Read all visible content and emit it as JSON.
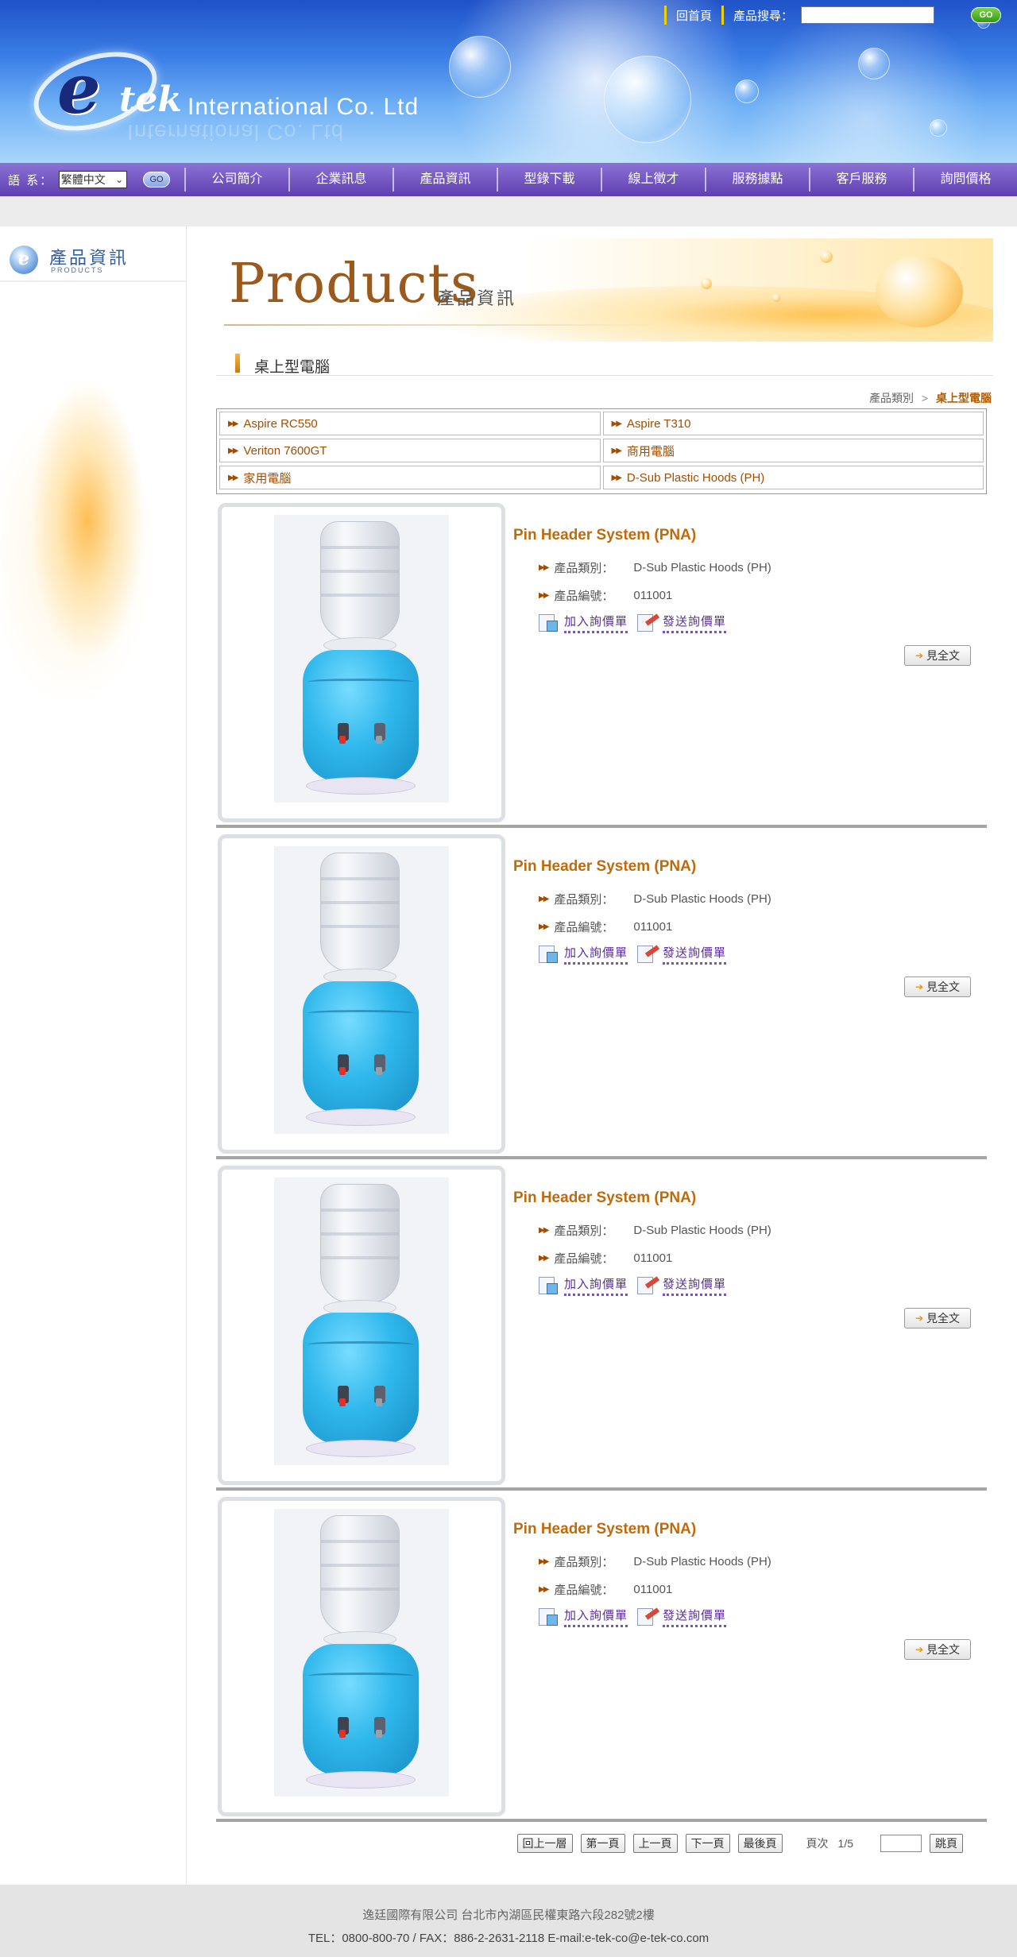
{
  "header": {
    "logo_letter": "e",
    "logo_tek": "tek",
    "company_name": "International Co. Ltd",
    "home_link": "回首頁",
    "search_label": "產品搜尋：",
    "search_value": "",
    "search_go": "GO"
  },
  "nav": {
    "lang_label": "語 系：",
    "lang_value": "繁體中文",
    "lang_go": "GO",
    "items": [
      "公司簡介",
      "企業訊息",
      "產品資訊",
      "型錄下載",
      "線上徵才",
      "服務據點",
      "客戶服務",
      "詢問價格"
    ]
  },
  "sidebar": {
    "title_zh": "產品資訊",
    "title_en": "PRODUCTS"
  },
  "banner": {
    "title_en": "Products",
    "title_zh": "產品資訊"
  },
  "category": {
    "heading": "桌上型電腦",
    "breadcrumb_root": "產品類別",
    "breadcrumb_sep": ">",
    "breadcrumb_current": "桌上型電腦",
    "links": [
      "Aspire RC550",
      "Aspire T310",
      "Veriton 7600GT",
      "商用電腦",
      "家用電腦",
      "D-Sub Plastic Hoods (PH)"
    ]
  },
  "products": [
    {
      "name": "Pin Header System (PNA)",
      "category_label": "產品類別：",
      "category_value": "D-Sub Plastic Hoods (PH)",
      "code_label": "產品編號：",
      "code_value": "011001",
      "add_label": "加入詢價單",
      "send_label": "發送詢價單",
      "full_label": "見全文"
    },
    {
      "name": "Pin Header System (PNA)",
      "category_label": "產品類別：",
      "category_value": "D-Sub Plastic Hoods (PH)",
      "code_label": "產品編號：",
      "code_value": "011001",
      "add_label": "加入詢價單",
      "send_label": "發送詢價單",
      "full_label": "見全文"
    },
    {
      "name": "Pin Header System (PNA)",
      "category_label": "產品類別：",
      "category_value": "D-Sub Plastic Hoods (PH)",
      "code_label": "產品編號：",
      "code_value": "011001",
      "add_label": "加入詢價單",
      "send_label": "發送詢價單",
      "full_label": "見全文"
    },
    {
      "name": "Pin Header System (PNA)",
      "category_label": "產品類別：",
      "category_value": "D-Sub Plastic Hoods (PH)",
      "code_label": "產品編號：",
      "code_value": "011001",
      "add_label": "加入詢價單",
      "send_label": "發送詢價單",
      "full_label": "見全文"
    }
  ],
  "pager": {
    "up": "回上一層",
    "first": "第一頁",
    "prev": "上一頁",
    "next": "下一頁",
    "last": "最後頁",
    "page_label": "頁次",
    "page_value": "1/5",
    "jump_value": "",
    "jump": "跳頁"
  },
  "footer": {
    "line1": "逸廷國際有限公司 台北市內湖區民權東路六段282號2樓",
    "line2": "TEL：0800-800-70 / FAX：886-2-2631-2118 E-mail:e-tek-co@e-tek-co.com"
  },
  "colors": {
    "accent_orange": "#c06a0a",
    "nav_purple": "#5e3fb0",
    "header_blue": "#3b7ee6"
  }
}
